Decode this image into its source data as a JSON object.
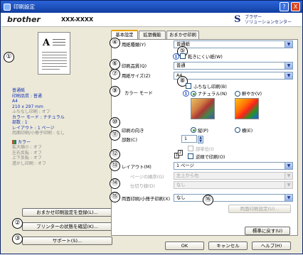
{
  "window": {
    "title": "印刷設定",
    "help_btn": "?",
    "close_btn": "X"
  },
  "header": {
    "brand": "brother",
    "model": "XXX-XXXX",
    "service_mark": "S",
    "service_line1": "ブラザー",
    "service_line2": "ソリューションセンター"
  },
  "preview": {
    "glyph": "A"
  },
  "summary": {
    "line1": "普通紙",
    "line2": "印刷品質 : 普通",
    "line3": "A4",
    "line4": "210 x 297 mm",
    "line5": "ふちなし印刷 : オフ",
    "line6": "カラー モード : ナチュラル",
    "line7": "部数 : 1",
    "line8": "レイアウト : 1 ページ",
    "line9": "両面印刷/小冊子印刷 : なし",
    "color_head": "カラー",
    "c1": "拡大縮小 : オフ",
    "c2": "左右反転 : オフ",
    "c3": "上下反転 : オフ",
    "c4": "透かし印刷 : オフ"
  },
  "left_buttons": {
    "register": "おまかせ印刷設定を登録(L)...",
    "status": "プリンターの状態を確認(K)...",
    "support": "サポート(S)..."
  },
  "tabs": {
    "basic": "基本設定",
    "advanced": "拡張機能",
    "omakase": "おまかせ印刷"
  },
  "form": {
    "media_label": "用紙種類(Y)",
    "media_value": "普通紙",
    "slow_dry": "乾きにくい紙(W)",
    "quality_label": "印刷品質(Q)",
    "quality_value": "普通",
    "size_label": "用紙サイズ(Z)",
    "size_value": "A4",
    "borderless": "ふちなし印刷(B)",
    "color_mode_label": "カラー モード",
    "natural": "ナチュラル(N)",
    "vivid": "鮮やか(V)",
    "orientation_label": "印刷の向き",
    "portrait": "縦(P)",
    "landscape": "横(E)",
    "copies_label": "部数(C)",
    "copies_value": "1",
    "collate": "部単位(I)",
    "reverse": "逆順で印刷(O)",
    "layout_label": "レイアウト(M)",
    "layout_value": "1 ページ",
    "page_order_label": "ページの順序(G)",
    "page_order_value": "左上から右",
    "border_label": "仕切り線(D)",
    "border_value": "なし",
    "duplex_label": "両面印刷/小冊子印刷(X)",
    "duplex_value": "なし",
    "duplex_settings": "両面印刷設定(U)...",
    "default_btn": "標準に戻す(U)"
  },
  "bottom": {
    "ok": "OK",
    "cancel": "キャンセル",
    "help": "ヘルプ(H)"
  },
  "markers": [
    "①",
    "②",
    "③",
    "④",
    "⑤",
    "⑥",
    "⑦",
    "⑧",
    "⑨",
    "⑩",
    "⑪",
    "⑫",
    "⑬",
    "⑭",
    "⑮",
    "⑯"
  ]
}
